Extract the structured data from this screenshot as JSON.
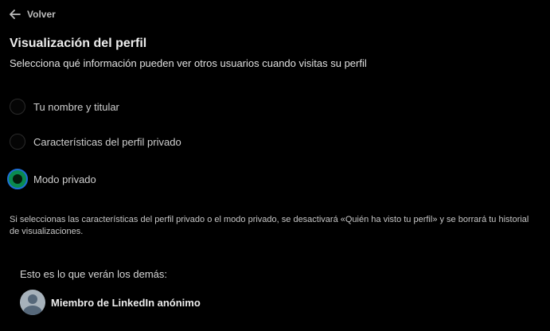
{
  "header": {
    "back_label": "Volver",
    "back_icon": "arrow-left-icon"
  },
  "section": {
    "title": "Visualización del perfil",
    "subtitle": "Selecciona qué información pueden ver otros usuarios cuando visitas su perfil"
  },
  "options": [
    {
      "label": "Tu nombre y titular",
      "selected": false
    },
    {
      "label": "Características del perfil privado",
      "selected": false
    },
    {
      "label": "Modo privado",
      "selected": true
    }
  ],
  "notice": "Si seleccionas las características del perfil privado o el modo privado, se desactivará «Quién ha visto tu perfil» y se borrará tu historial de visualizaciones.",
  "preview": {
    "heading": "Esto es lo que verán los demás:",
    "member_name": "Miembro de LinkedIn anónimo",
    "avatar_icon": "anonymous-avatar-icon"
  },
  "colors": {
    "background": "#000000",
    "radio_selected_fill": "#0a8a4f",
    "radio_selected_ring": "#1f6fd6"
  }
}
